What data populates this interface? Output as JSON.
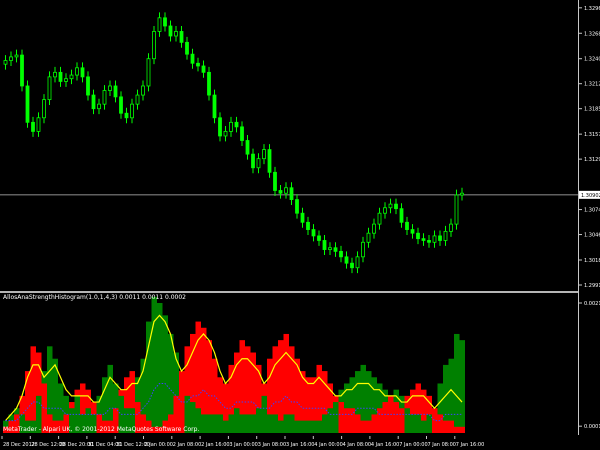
{
  "chart_data": [
    {
      "type": "candlestick",
      "title": "",
      "colors": {
        "up": "#00ff00",
        "down": "#00ff00",
        "background": "#000000",
        "grid": "#c0c0c0",
        "axis_text": "#ffffff"
      },
      "ylim": [
        1.2991,
        1.3298
      ],
      "y_ticks": [
        "1.32960",
        "1.32680",
        "1.32400",
        "1.32125",
        "1.31850",
        "1.31570",
        "1.31295",
        "1.30740",
        "1.30465",
        "1.30185",
        "1.29910"
      ],
      "current_price": "1.30902",
      "closes": [
        1.3238,
        1.3242,
        1.3244,
        1.321,
        1.317,
        1.316,
        1.3175,
        1.3195,
        1.322,
        1.3225,
        1.3215,
        1.3218,
        1.3222,
        1.323,
        1.322,
        1.32,
        1.3185,
        1.319,
        1.3205,
        1.321,
        1.3198,
        1.318,
        1.3175,
        1.319,
        1.32,
        1.321,
        1.324,
        1.327,
        1.3285,
        1.3276,
        1.3265,
        1.327,
        1.3258,
        1.3245,
        1.3235,
        1.3232,
        1.3225,
        1.32,
        1.3175,
        1.3155,
        1.316,
        1.317,
        1.3165,
        1.315,
        1.3135,
        1.312,
        1.313,
        1.314,
        1.3115,
        1.3095,
        1.3092,
        1.3098,
        1.3085,
        1.307,
        1.306,
        1.3052,
        1.3045,
        1.304,
        1.303,
        1.3032,
        1.3028,
        1.3022,
        1.3015,
        1.301,
        1.3022,
        1.3038,
        1.3048,
        1.3058,
        1.307,
        1.3076,
        1.308,
        1.3075,
        1.306,
        1.3052,
        1.3048,
        1.3042,
        1.304,
        1.3038,
        1.3045,
        1.304,
        1.305,
        1.3058,
        1.309,
        1.3092
      ]
    },
    {
      "type": "histogram+line",
      "title": "AllosAnaStrengthHistogram(1.0,1,4,3) 0.0011 0.0011 0.0002",
      "ylim": [
        0,
        0.0021
      ],
      "y_ticks": [
        "0.0021",
        "0.00011"
      ],
      "series": [
        {
          "name": "bull",
          "color": "#008000",
          "values": [
            0.0002,
            0.0003,
            0.0004,
            0.0003,
            0.0002,
            0.0002,
            0.0006,
            0.001,
            0.0014,
            0.0012,
            0.0008,
            0.0006,
            0.0004,
            0.0006,
            0.0003,
            0.0004,
            0.0003,
            0.0006,
            0.0009,
            0.0011,
            0.0008,
            0.0006,
            0.0004,
            0.0004,
            0.0009,
            0.0012,
            0.0018,
            0.0022,
            0.0021,
            0.0019,
            0.0016,
            0.0013,
            0.001,
            0.0006,
            0.0005,
            0.0004,
            0.0003,
            0.0003,
            0.0003,
            0.0003,
            0.0002,
            0.0003,
            0.0004,
            0.0003,
            0.0003,
            0.0003,
            0.0004,
            0.0006,
            0.0003,
            0.0003,
            0.0002,
            0.0003,
            0.0003,
            0.0002,
            0.0002,
            0.0002,
            0.0002,
            0.0002,
            0.0003,
            0.0004,
            0.0005,
            0.0007,
            0.0008,
            0.0009,
            0.001,
            0.0011,
            0.001,
            0.0009,
            0.0008,
            0.0007,
            0.0006,
            0.0007,
            0.0006,
            0.0004,
            0.0003,
            0.0003,
            0.0002,
            0.0003,
            0.0004,
            0.0008,
            0.0011,
            0.0012,
            0.0016,
            0.0015
          ]
        },
        {
          "name": "bear",
          "color": "#ff0000",
          "values": [
            0.0001,
            0.0002,
            0.0003,
            0.0006,
            0.001,
            0.0014,
            0.0013,
            0.0008,
            0.0003,
            0.0002,
            0.0002,
            0.0003,
            0.0005,
            0.0007,
            0.0008,
            0.0007,
            0.0005,
            0.0003,
            0.0002,
            0.0002,
            0.0004,
            0.0007,
            0.0009,
            0.001,
            0.0005,
            0.0003,
            0.0002,
            0.0001,
            0.0001,
            0.0002,
            0.0003,
            0.0006,
            0.001,
            0.0014,
            0.0016,
            0.0018,
            0.0017,
            0.0015,
            0.0012,
            0.0009,
            0.0008,
            0.0011,
            0.0013,
            0.0015,
            0.0014,
            0.0013,
            0.0011,
            0.0008,
            0.0012,
            0.0014,
            0.0015,
            0.0016,
            0.0014,
            0.0012,
            0.001,
            0.0009,
            0.0009,
            0.0011,
            0.001,
            0.0008,
            0.0006,
            0.0005,
            0.0004,
            0.0004,
            0.0003,
            0.0002,
            0.0002,
            0.0003,
            0.0004,
            0.0005,
            0.0006,
            0.0005,
            0.0004,
            0.0006,
            0.0007,
            0.0008,
            0.0007,
            0.0006,
            0.0004,
            0.0003,
            0.0002,
            0.0002,
            0.0001,
            0.0001
          ]
        },
        {
          "name": "signal",
          "color": "#ffff00",
          "values": [
            0.0002,
            0.0003,
            0.0004,
            0.0006,
            0.0009,
            0.0011,
            0.0011,
            0.0009,
            0.001,
            0.0011,
            0.0009,
            0.0007,
            0.0006,
            0.0006,
            0.0006,
            0.0006,
            0.0005,
            0.0005,
            0.0007,
            0.0009,
            0.0008,
            0.0007,
            0.0007,
            0.0008,
            0.0008,
            0.001,
            0.0014,
            0.0018,
            0.0019,
            0.0018,
            0.0016,
            0.0012,
            0.001,
            0.0011,
            0.0013,
            0.0015,
            0.0016,
            0.0015,
            0.0013,
            0.001,
            0.0008,
            0.0009,
            0.0011,
            0.0012,
            0.0012,
            0.0011,
            0.001,
            0.0008,
            0.0009,
            0.0011,
            0.0012,
            0.0013,
            0.0012,
            0.0011,
            0.0009,
            0.0008,
            0.0008,
            0.0009,
            0.0008,
            0.0007,
            0.0006,
            0.0006,
            0.0007,
            0.0007,
            0.0008,
            0.0008,
            0.0008,
            0.0007,
            0.0007,
            0.0006,
            0.0006,
            0.0006,
            0.0005,
            0.0005,
            0.0006,
            0.0006,
            0.0006,
            0.0005,
            0.0004,
            0.0005,
            0.0006,
            0.0007,
            0.0006,
            0.0005
          ]
        },
        {
          "name": "dots",
          "color": "#4040ff",
          "values": [
            0.0002,
            0.0002,
            0.0002,
            0.0003,
            0.0004,
            0.0005,
            0.0005,
            0.0004,
            0.0004,
            0.0004,
            0.0004,
            0.0003,
            0.0003,
            0.0003,
            0.0003,
            0.0003,
            0.0003,
            0.0003,
            0.0003,
            0.0004,
            0.0004,
            0.0003,
            0.0003,
            0.0003,
            0.0003,
            0.0004,
            0.0005,
            0.0007,
            0.0008,
            0.0008,
            0.0007,
            0.0006,
            0.0005,
            0.0005,
            0.0006,
            0.0006,
            0.0007,
            0.0006,
            0.0006,
            0.0005,
            0.0004,
            0.0004,
            0.0005,
            0.0005,
            0.0005,
            0.0005,
            0.0004,
            0.0004,
            0.0004,
            0.0005,
            0.0005,
            0.0006,
            0.0005,
            0.0005,
            0.0004,
            0.0004,
            0.0004,
            0.0004,
            0.0004,
            0.0003,
            0.0003,
            0.0003,
            0.0003,
            0.0003,
            0.0004,
            0.0004,
            0.0004,
            0.0004,
            0.0003,
            0.0003,
            0.0003,
            0.0003,
            0.0003,
            0.0003,
            0.0003,
            0.0003,
            0.0003,
            0.0003,
            0.0002,
            0.0002,
            0.0003,
            0.0003,
            0.0003,
            0.0003
          ]
        }
      ]
    }
  ],
  "time_axis": [
    "28 Dec 2012",
    "28 Dec 12:00",
    "28 Dec 20:00",
    "31 Dec 04:00",
    "31 Dec 12:00",
    "2 Jan 00:00",
    "2 Jan 08:00",
    "2 Jan 16:00",
    "3 Jan 00:00",
    "3 Jan 08:00",
    "3 Jan 16:00",
    "4 Jan 00:00",
    "4 Jan 08:00",
    "4 Jan 16:00",
    "7 Jan 00:00",
    "7 Jan 08:00",
    "7 Jan 16:00"
  ],
  "indicator_title": "AllosAnaStrengthHistogram(1.0,1,4,3) 0.0011 0.0011 0.0002",
  "copyright": "MetaTrader - Alpari UK, © 2001-2012 MetaQuotes Software Corp."
}
